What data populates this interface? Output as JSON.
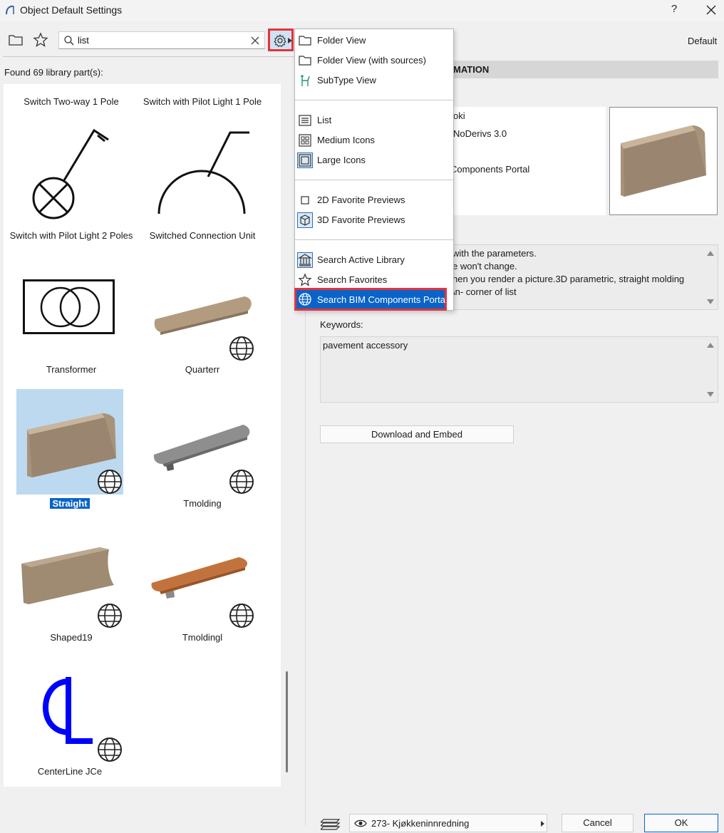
{
  "window": {
    "title": "Object Default Settings",
    "help_label": "?"
  },
  "search": {
    "value": "list",
    "placeholder": ""
  },
  "found_label": "Found 69 library part(s):",
  "library_items": [
    {
      "label": "Switch Two-way 1 Pole"
    },
    {
      "label": "Switch with Pilot Light 1 Pole"
    },
    {
      "label": "Switch with Pilot Light 2 Poles"
    },
    {
      "label": "Switched Connection Unit"
    },
    {
      "label": "Transformer"
    },
    {
      "label": "Quarterr"
    },
    {
      "label": "Straight",
      "selected": true
    },
    {
      "label": "Tmolding"
    },
    {
      "label": "Shaped19"
    },
    {
      "label": "Tmoldingl"
    },
    {
      "label": "CenterLine JCe"
    }
  ],
  "menu": {
    "items": [
      {
        "label": "Folder View",
        "icon": "folder-icon"
      },
      {
        "label": "Folder View (with sources)",
        "icon": "folder-icon"
      },
      {
        "label": "SubType View",
        "icon": "subtype-icon"
      },
      {
        "label": "List",
        "icon": "list-view-icon"
      },
      {
        "label": "Medium Icons",
        "icon": "medium-icons-icon"
      },
      {
        "label": "Large Icons",
        "icon": "large-icons-icon"
      },
      {
        "label": "2D Favorite Previews",
        "icon": "square-icon"
      },
      {
        "label": "3D Favorite Previews",
        "icon": "cube-icon"
      },
      {
        "label": "Search Active Library",
        "icon": "library-icon"
      },
      {
        "label": "Search Favorites",
        "icon": "star-icon"
      },
      {
        "label": "Search BIM Components Porta",
        "icon": "globe-icon"
      }
    ]
  },
  "right_panel": {
    "default_label": "Default",
    "info_header": "MATION",
    "info_lines": [
      "oki",
      "NoDerivs 3.0",
      "Components Portal"
    ],
    "description_lines": [
      "with the parameters.",
      "e won't change.",
      "hen you render a picture.3D parametric, straight molding",
      "\\n- corner of list"
    ],
    "keywords_label": "Keywords:",
    "keywords_value": "pavement accessory",
    "download_button": "Download and Embed"
  },
  "bottom_bar": {
    "layer_value": "273- Kjøkkeninnredning",
    "cancel_label": "Cancel",
    "ok_label": "OK"
  },
  "colors": {
    "selection": "#0a64c8",
    "highlight_border": "#e5333a",
    "selected_item_bg": "#bcd9f0",
    "centerline_blue": "#0000ff"
  }
}
